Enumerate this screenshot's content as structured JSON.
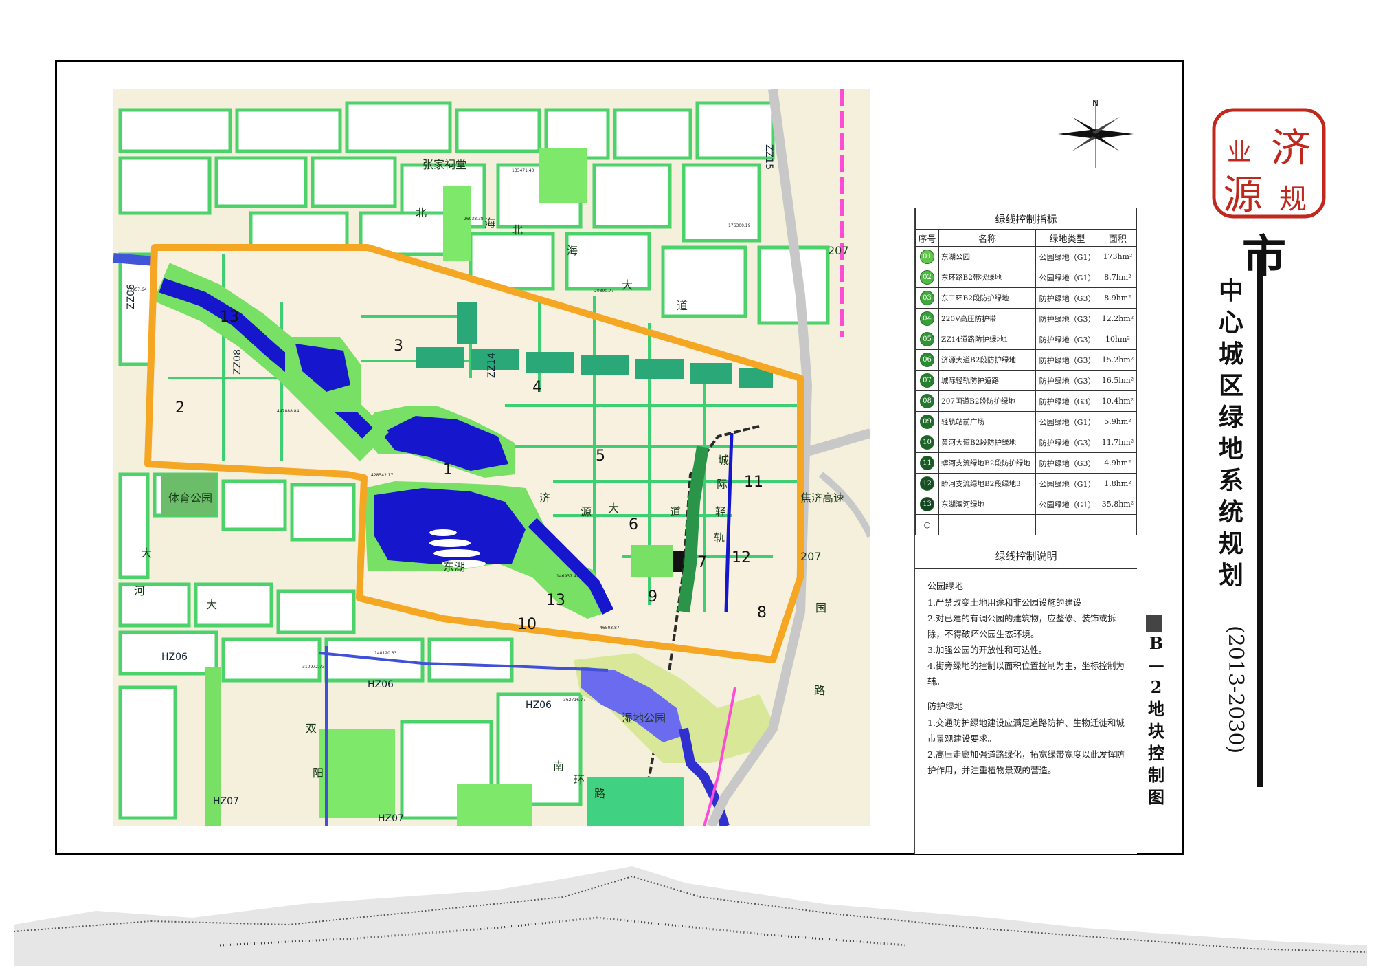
{
  "title": {
    "big_char": "市",
    "vertical_title": "中心城区绿地系统规划",
    "years": "(2013-2030)",
    "sheet_code": "B—2地块控制图"
  },
  "seal": {
    "chars": [
      "济",
      "源",
      "规",
      "业"
    ],
    "color": "#c0281e"
  },
  "compass": {
    "north_label": "N"
  },
  "legend": {
    "caption": "绿线控制指标",
    "headers": [
      "序号",
      "名称",
      "绿地类型",
      "面积"
    ],
    "rows": [
      {
        "no": "01",
        "name": "东湖公园",
        "type": "公园绿地（G1）",
        "area": "173hm²",
        "color": "#5fc84a"
      },
      {
        "no": "02",
        "name": "东环路B2带状绿地",
        "type": "公园绿地（G1）",
        "area": "8.7hm²",
        "color": "#4cbc42"
      },
      {
        "no": "03",
        "name": "东二环B2段防护绿地",
        "type": "防护绿地（G3）",
        "area": "8.9hm²",
        "color": "#3eaa3a"
      },
      {
        "no": "04",
        "name": "220V高压防护带",
        "type": "防护绿地（G3）",
        "area": "12.2hm²",
        "color": "#34a036"
      },
      {
        "no": "05",
        "name": "ZZ14道路防护绿地1",
        "type": "防护绿地（G3）",
        "area": "10hm²",
        "color": "#2e9632"
      },
      {
        "no": "06",
        "name": "济源大道B2段防护绿地",
        "type": "防护绿地（G3）",
        "area": "15.2hm²",
        "color": "#2a8c30"
      },
      {
        "no": "07",
        "name": "城际轻轨防护道路",
        "type": "防护绿地（G3）",
        "area": "16.5hm²",
        "color": "#26822e"
      },
      {
        "no": "08",
        "name": "207国道B2段防护绿地",
        "type": "防护绿地（G3）",
        "area": "10.4hm²",
        "color": "#22782c"
      },
      {
        "no": "09",
        "name": "轻轨站前广场",
        "type": "公园绿地（G1）",
        "area": "5.9hm²",
        "color": "#1f6e2a"
      },
      {
        "no": "10",
        "name": "黄河大道B2段防护绿地",
        "type": "防护绿地（G3）",
        "area": "11.7hm²",
        "color": "#1c6428"
      },
      {
        "no": "11",
        "name": "蟒河支流绿地B2段防护绿地",
        "type": "防护绿地（G3）",
        "area": "4.9hm²",
        "color": "#195a26"
      },
      {
        "no": "12",
        "name": "蟒河支流绿地B2段绿地3",
        "type": "公园绿地（G1）",
        "area": "1.8hm²",
        "color": "#165024"
      },
      {
        "no": "13",
        "name": "东湖滨河绿地",
        "type": "公园绿地（G1）",
        "area": "35.8hm²",
        "color": "#134622"
      }
    ]
  },
  "notes": {
    "caption": "绿线控制说明",
    "park_title": "公园绿地",
    "park_items": [
      "1.严禁改变土地用途和非公园设施的建设",
      "2.对已建的有调公园的建筑物，应整修、装饰或拆除，不得破坏公园生态环境。",
      "3.加强公园的开放性和可达性。",
      "4.街旁绿地的控制以面积位置控制为主，坐标控制为辅。"
    ],
    "protect_title": "防护绿地",
    "protect_items": [
      "1.交通防护绿地建设应满足道路防护、生物迁徙和城市景观建设要求。",
      "2.高压走廊加强道路绿化，拓宽绿带宽度以此发挥防护作用，并注重植物景观的营造。"
    ]
  },
  "map": {
    "places": {
      "zhangjia": "张家祠堂",
      "sports_park": "体育公园",
      "donghu": "东湖",
      "wetland": "湿地公园",
      "jiaoji": "焦济高速",
      "g207_a": "207",
      "g207_b": "207"
    },
    "road_codes": [
      "HZ06",
      "HZ06",
      "HZ06",
      "HZ07",
      "HZ07",
      "ZZ14",
      "ZZ15",
      "ZZ08",
      "ZZ06"
    ],
    "plot_numbers": [
      "1",
      "2",
      "3",
      "4",
      "5",
      "6",
      "7",
      "8",
      "9",
      "10",
      "11",
      "12",
      "13",
      "13"
    ],
    "road_chars": [
      "北",
      "海",
      "大",
      "道",
      "济",
      "源",
      "大",
      "道",
      "城",
      "际",
      "轻",
      "轨",
      "国",
      "路",
      "南",
      "环",
      "路",
      "河",
      "大",
      "双",
      "阳",
      "大",
      "北",
      "海"
    ],
    "areas": [
      "26038.38",
      "20890.77",
      "133471.40",
      "176300.19",
      "25957.64",
      "447088.84",
      "428542.17",
      "146937.42",
      "46503.87",
      "362716.77",
      "310972.73",
      "148120.33"
    ]
  }
}
